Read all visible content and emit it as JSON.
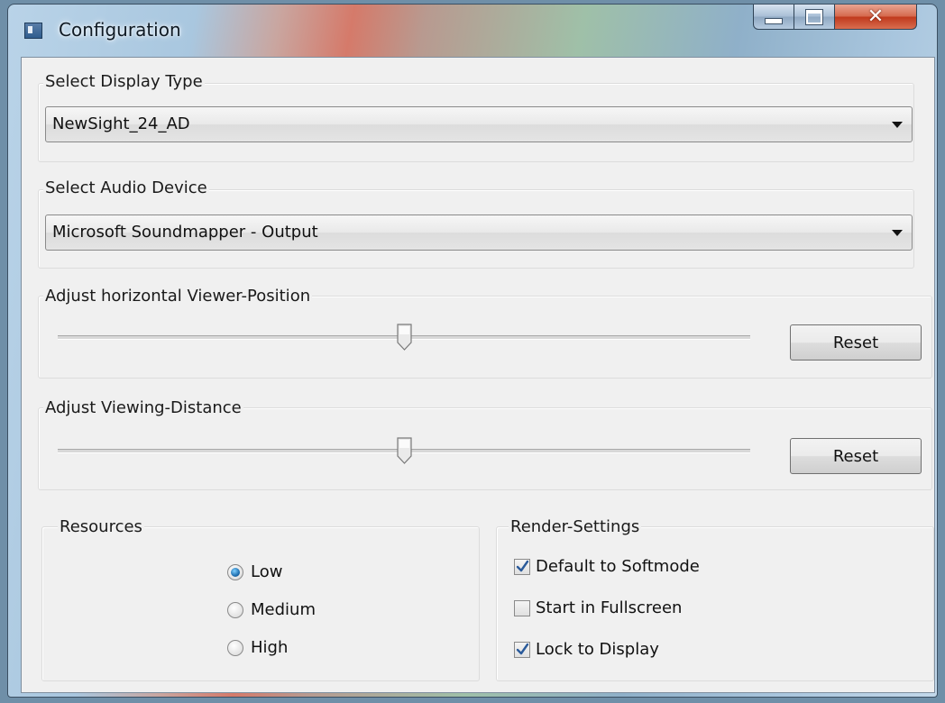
{
  "window": {
    "title": "Configuration",
    "icon": "app-window-icon",
    "controls": [
      "minimize-icon",
      "maximize-icon",
      "close-icon"
    ]
  },
  "display_type": {
    "label": "Select Display Type",
    "selected": "NewSight_24_AD"
  },
  "audio_device": {
    "label": "Select Audio Device",
    "selected": "Microsoft Soundmapper - Output"
  },
  "horizontal_position": {
    "label": "Adjust horizontal Viewer-Position",
    "slider_fraction": 0.5,
    "reset_label": "Reset"
  },
  "viewing_distance": {
    "label": "Adjust Viewing-Distance",
    "slider_fraction": 0.5,
    "reset_label": "Reset"
  },
  "resources": {
    "label": "Resources",
    "options": [
      {
        "label": "Low",
        "selected": true
      },
      {
        "label": "Medium",
        "selected": false
      },
      {
        "label": "High",
        "selected": false
      }
    ]
  },
  "render_settings": {
    "label": "Render-Settings",
    "options": [
      {
        "label": "Default to Softmode",
        "checked": true
      },
      {
        "label": "Start in Fullscreen",
        "checked": false
      },
      {
        "label": "Lock to Display",
        "checked": true
      }
    ]
  },
  "colors": {
    "radio_selected": "#1f6fb0",
    "close_button": "#c0391c",
    "client_background": "#f0f0f0"
  }
}
